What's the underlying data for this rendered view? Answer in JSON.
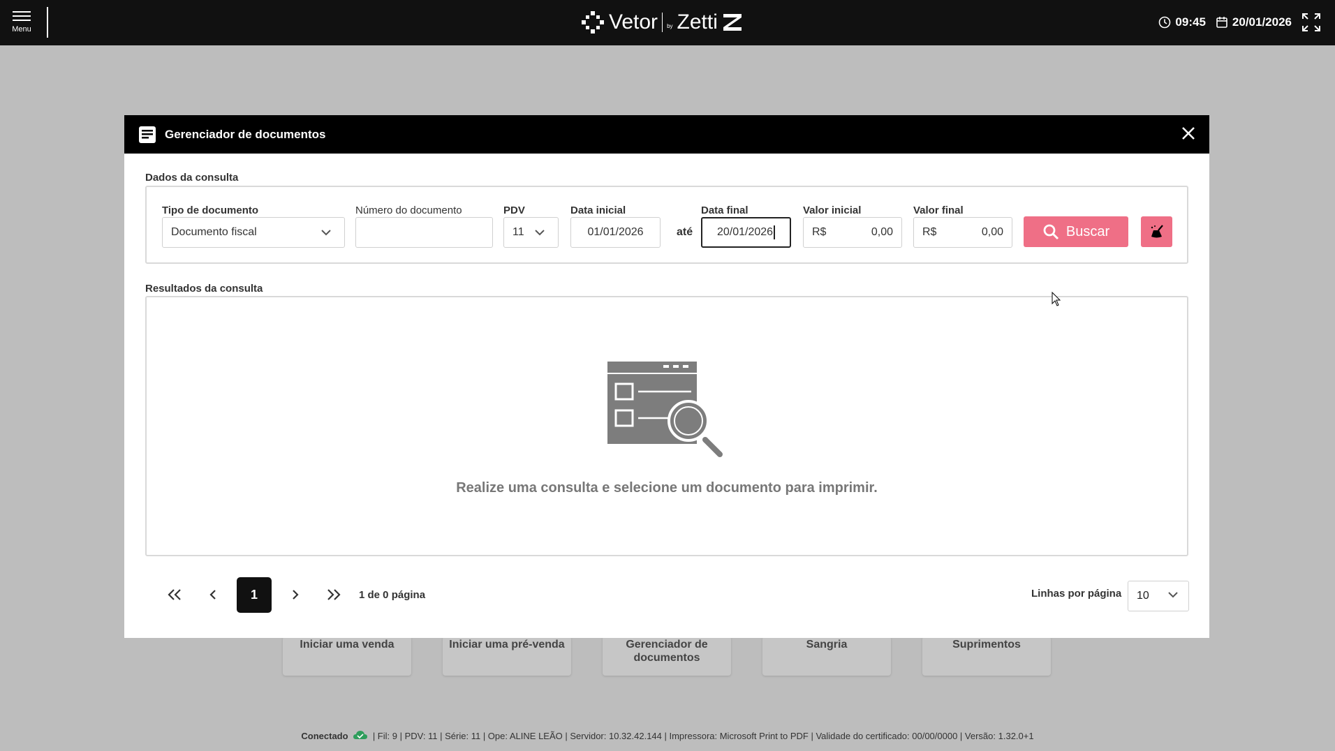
{
  "topbar": {
    "menu_label": "Menu",
    "brand_left": "Vetor",
    "brand_by": "by",
    "brand_right": "Zetti",
    "time": "09:45",
    "date": "20/01/2026"
  },
  "background_cards": [
    {
      "label": "Iniciar uma venda"
    },
    {
      "label": "Iniciar uma pré-venda"
    },
    {
      "label": "Gerenciador de documentos"
    },
    {
      "label": "Sangria"
    },
    {
      "label": "Suprimentos"
    }
  ],
  "modal": {
    "title": "Gerenciador de documentos",
    "query_section_title": "Dados da consulta",
    "results_section_title": "Resultados da consulta",
    "fields": {
      "tipo_documento": {
        "label": "Tipo de documento",
        "value": "Documento fiscal"
      },
      "numero_documento": {
        "label": "Número do documento",
        "value": ""
      },
      "pdv": {
        "label": "PDV",
        "value": "11"
      },
      "data_inicial": {
        "label": "Data inicial",
        "value": "01/01/2026"
      },
      "ate": "até",
      "data_final": {
        "label": "Data final",
        "value": "20/01/2026"
      },
      "valor_inicial": {
        "label": "Valor inicial",
        "currency": "R$",
        "value": "0,00"
      },
      "valor_final": {
        "label": "Valor final",
        "currency": "R$",
        "value": "0,00"
      }
    },
    "search_button": "Buscar",
    "empty_message": "Realize uma consulta e selecione um documento para imprimir.",
    "pagination": {
      "current_page": "1",
      "info": "1 de 0 página",
      "rows_label": "Linhas por página",
      "rows_value": "10"
    }
  },
  "status_bar": {
    "connected_label": "Conectado",
    "details": "| Fil: 9 | PDV: 11 | Série: 11 | Ope: ALINE LEÃO | Servidor: 10.32.42.144 | Impressora: Microsoft Print to PDF | Validade do certificado: 00/00/0000 | Versão: 1.32.0+1"
  },
  "colors": {
    "accent": "#ef6f86",
    "header_bg": "#111111",
    "overlay_bg": "#bdbdbd",
    "connected_icon": "#2e9d5b"
  },
  "icons": [
    "hamburger-icon",
    "clock-icon",
    "calendar-icon",
    "fullscreen-icon",
    "document-icon",
    "close-icon",
    "chevron-down-icon",
    "search-icon",
    "broom-icon",
    "first-page-icon",
    "prev-page-icon",
    "next-page-icon",
    "last-page-icon",
    "cloud-icon"
  ]
}
